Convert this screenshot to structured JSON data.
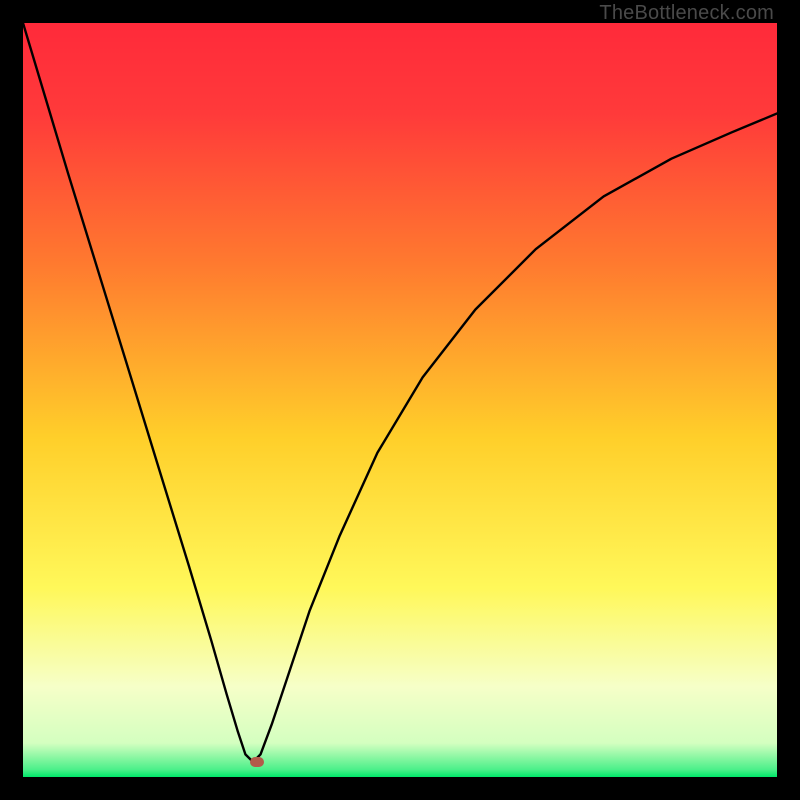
{
  "watermark": {
    "text": "TheBottleneck.com"
  },
  "colors": {
    "gradient_top": "#ff2a3a",
    "gradient_mid1": "#ff8a2a",
    "gradient_mid2": "#ffe82a",
    "gradient_mid3": "#f7ffb0",
    "gradient_bottom": "#00e86a",
    "curve": "#000000",
    "marker": "#b35a4a",
    "frame": "#000000"
  },
  "chart_data": {
    "type": "line",
    "title": "",
    "xlabel": "",
    "ylabel": "",
    "xlim": [
      0,
      100
    ],
    "ylim": [
      0,
      100
    ],
    "grid": false,
    "legend": false,
    "annotations": [],
    "series": [
      {
        "name": "curve",
        "x": [
          0,
          3,
          6,
          10,
          14,
          18,
          22,
          25,
          27,
          28.5,
          29.5,
          30.5,
          31.5,
          33,
          35,
          38,
          42,
          47,
          53,
          60,
          68,
          77,
          86,
          94,
          100
        ],
        "y": [
          100,
          90,
          80,
          67,
          54,
          41,
          28,
          18,
          11,
          6,
          3,
          2,
          3,
          7,
          13,
          22,
          32,
          43,
          53,
          62,
          70,
          77,
          82,
          85.5,
          88
        ]
      }
    ],
    "marker": {
      "x": 31,
      "y": 2
    },
    "notes": "Values are approximate percentages read from the figure; the V-shaped curve reaches its minimum near x≈30–31 at y≈2 and rises toward y≈88 at x=100. The vertical gradient background runs red→orange→yellow→pale-yellow→green from top to bottom."
  }
}
